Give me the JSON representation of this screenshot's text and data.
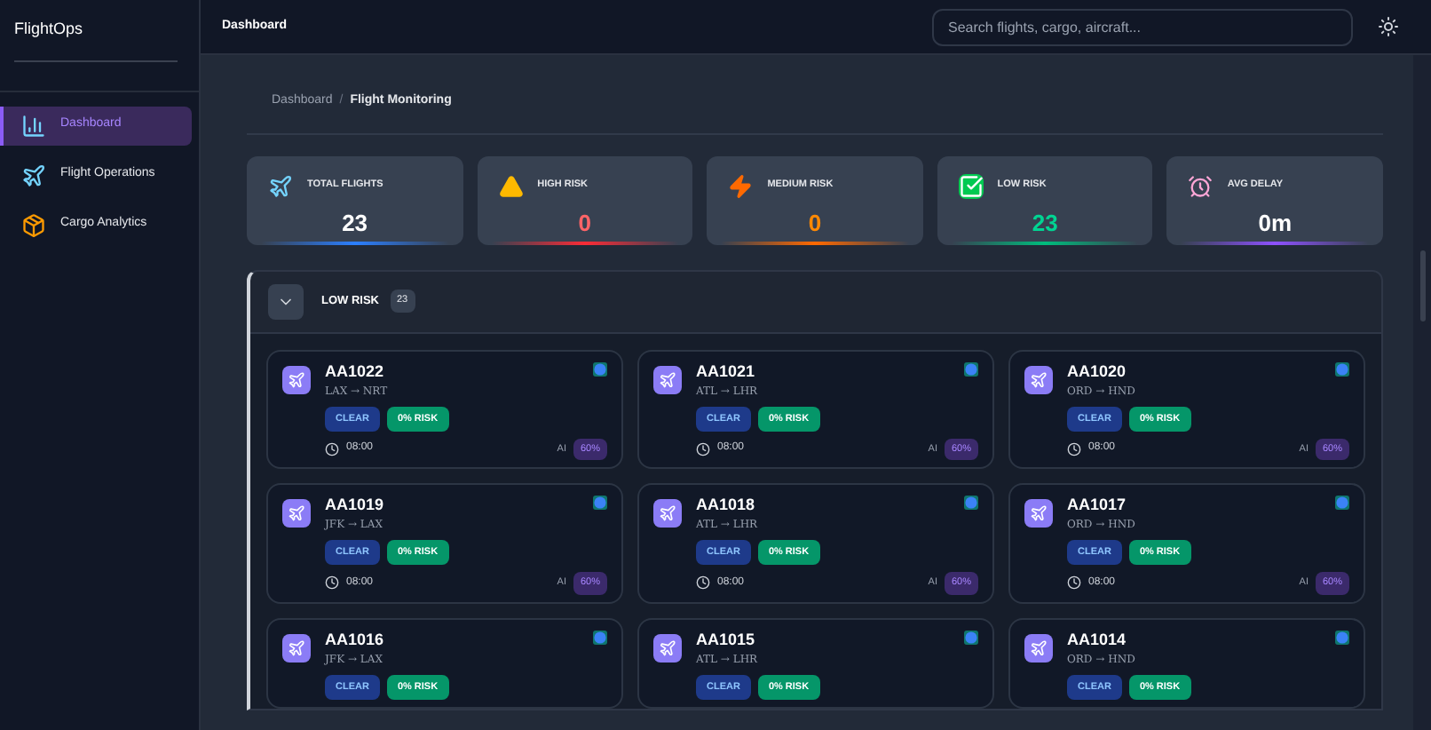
{
  "sidebar": {
    "brand": "FlightOps",
    "items": [
      {
        "label": "Dashboard",
        "selected": true
      },
      {
        "label": "Flight Operations",
        "selected": false
      },
      {
        "label": "Cargo Analytics",
        "selected": false
      }
    ]
  },
  "header": {
    "title": "Dashboard",
    "search": {
      "placeholder": "Search flights, cargo, aircraft..."
    }
  },
  "breadcrumb": {
    "parent": "Dashboard",
    "separator": "/",
    "current": "Flight Monitoring"
  },
  "stats": [
    {
      "kind": "total",
      "label": "TOTAL FLIGHTS",
      "value": "23"
    },
    {
      "kind": "high",
      "label": "HIGH RISK",
      "value": "0"
    },
    {
      "kind": "medium",
      "label": "MEDIUM RISK",
      "value": "0"
    },
    {
      "kind": "low",
      "label": "LOW RISK",
      "value": "23"
    },
    {
      "kind": "delay",
      "label": "AVG DELAY",
      "value": "0m"
    }
  ],
  "group": {
    "title": "LOW RISK",
    "count": "23",
    "expanded": true
  },
  "flights": [
    {
      "id": "AA1022",
      "route": "LAX → NRT",
      "status": "CLEAR",
      "risk": "0% RISK",
      "time": "08:00",
      "ai_label": "AI",
      "ai": "60%"
    },
    {
      "id": "AA1021",
      "route": "ATL → LHR",
      "status": "CLEAR",
      "risk": "0% RISK",
      "time": "08:00",
      "ai_label": "AI",
      "ai": "60%"
    },
    {
      "id": "AA1020",
      "route": "ORD → HND",
      "status": "CLEAR",
      "risk": "0% RISK",
      "time": "08:00",
      "ai_label": "AI",
      "ai": "60%"
    },
    {
      "id": "AA1019",
      "route": "JFK → LAX",
      "status": "CLEAR",
      "risk": "0% RISK",
      "time": "08:00",
      "ai_label": "AI",
      "ai": "60%"
    },
    {
      "id": "AA1018",
      "route": "ATL → LHR",
      "status": "CLEAR",
      "risk": "0% RISK",
      "time": "08:00",
      "ai_label": "AI",
      "ai": "60%"
    },
    {
      "id": "AA1017",
      "route": "ORD → HND",
      "status": "CLEAR",
      "risk": "0% RISK",
      "time": "08:00",
      "ai_label": "AI",
      "ai": "60%"
    },
    {
      "id": "AA1016",
      "route": "JFK → LAX",
      "status": "CLEAR",
      "risk": "0% RISK"
    },
    {
      "id": "AA1015",
      "route": "ATL → LHR",
      "status": "CLEAR",
      "risk": "0% RISK"
    },
    {
      "id": "AA1014",
      "route": "ORD → HND",
      "status": "CLEAR",
      "risk": "0% RISK"
    }
  ]
}
